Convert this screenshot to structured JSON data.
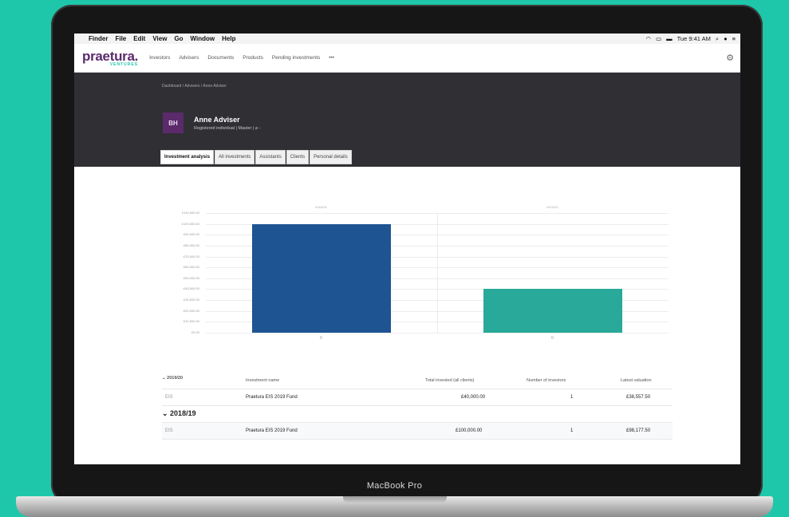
{
  "device": {
    "label": "MacBook Pro"
  },
  "menubar": {
    "apple": "",
    "items": [
      "Finder",
      "File",
      "Edit",
      "View",
      "Go",
      "Window",
      "Help"
    ],
    "clock": "Tue 9:41 AM"
  },
  "nav": {
    "logo_main": "praetura.",
    "logo_sub": "VENTURES",
    "links": [
      "Investors",
      "Advisers",
      "Documents",
      "Products",
      "Pending investments",
      "•••"
    ]
  },
  "hero": {
    "breadcrumb": "Dashboard / Advisers / Anne Adviser",
    "avatar_initials": "BH",
    "name": "Anne Adviser",
    "meta": "Registered individual | Master | ⌀ -"
  },
  "tabs": [
    "Investment analysis",
    "All investments",
    "Assistants",
    "Clients",
    "Personal details"
  ],
  "chart_data": {
    "type": "bar",
    "categories": [
      "2018/19",
      "2019/20"
    ],
    "x_labels": [
      "0",
      "0"
    ],
    "values": [
      100000,
      40000
    ],
    "yticks": [
      "£0.00",
      "£10,000.00",
      "£20,000.00",
      "£30,000.00",
      "£40,000.00",
      "£50,000.00",
      "£60,000.00",
      "£70,000.00",
      "£80,000.00",
      "£90,000.00",
      "£100,000.00",
      "£110,000.00"
    ],
    "ylim": [
      0,
      110000
    ],
    "colors": [
      "#1f5493",
      "#28a99a"
    ]
  },
  "table": {
    "headers": [
      "Investment name",
      "Total invested (all clients)",
      "Number of investors",
      "Latest valuation"
    ],
    "groups": [
      {
        "label": "2019/20",
        "rows": [
          {
            "type": "EIS",
            "name": "Praetura EIS 2019 Fund",
            "total": "£40,000.00",
            "investors": "1",
            "valuation": "£38,557.50"
          }
        ]
      },
      {
        "label": "2018/19",
        "rows": [
          {
            "type": "EIS",
            "name": "Praetura EIS 2019 Fund",
            "total": "£100,000.00",
            "investors": "1",
            "valuation": "£98,177.50"
          }
        ]
      }
    ]
  },
  "colors": {
    "background": "#1ec7aa",
    "brand": "#5a2a6b",
    "hero": "#2f2f34"
  }
}
